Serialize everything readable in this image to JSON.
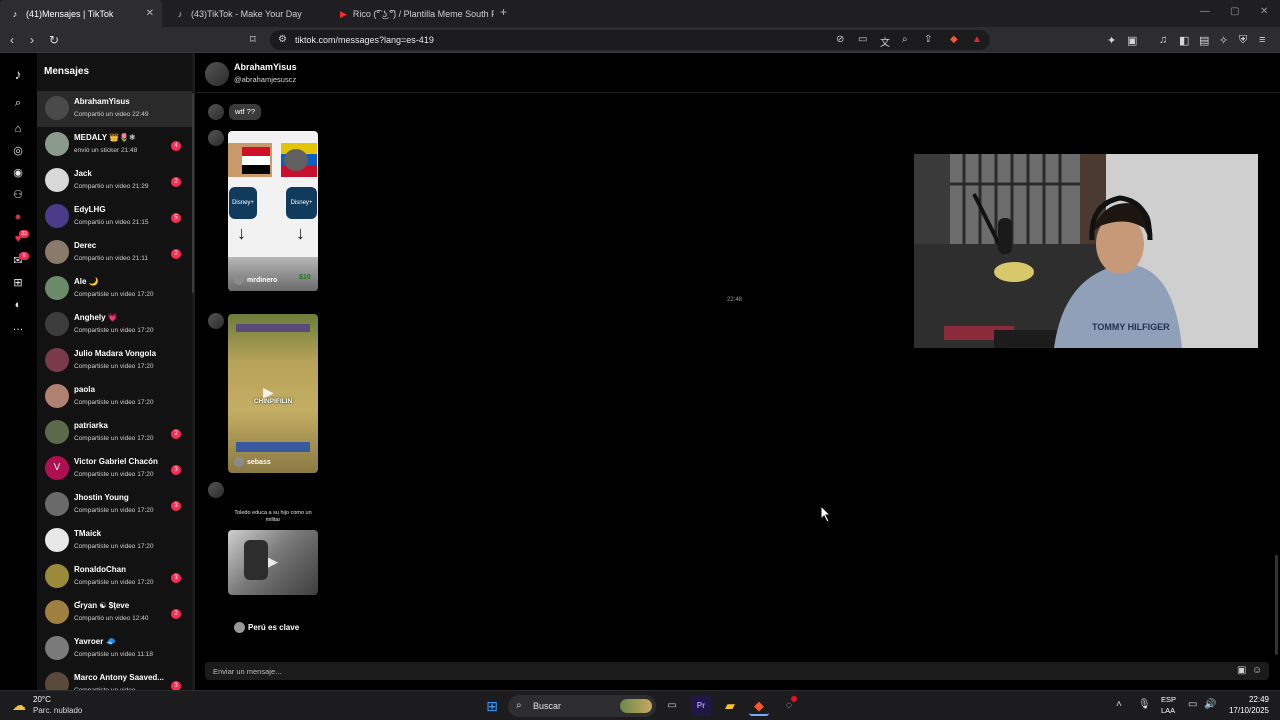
{
  "browser": {
    "tabs": [
      {
        "title": "(41)Mensajes | TikTok",
        "icon": "tiktok-icon",
        "active": true
      },
      {
        "title": "(43)TikTok - Make Your Day",
        "icon": "tiktok-icon",
        "active": false
      },
      {
        "title": "Rico (͡° ͜ʖ ͡°) / Plantilla Meme South P...",
        "icon": "youtube-icon",
        "active": false
      }
    ],
    "new_tab": "+",
    "url": "tiktok.com/messages?lang=es-419"
  },
  "sidebar": {
    "title": "Mensajes",
    "notification_badges": [
      "33",
      "8"
    ]
  },
  "conversations": [
    {
      "name": "AbrahamYisus",
      "preview": "Compartió un video 22:49",
      "badge": "",
      "selected": true,
      "color": "#4a4a4a",
      "initial": ""
    },
    {
      "name": "MEDALY 👑🌷❄",
      "preview": "envió un sticker 21:48",
      "badge": "4",
      "selected": false,
      "color": "#8a9a8a",
      "initial": ""
    },
    {
      "name": "Jack",
      "preview": "Compartió un video 21:29",
      "badge": "2",
      "selected": false,
      "color": "#d8d8d8",
      "initial": ""
    },
    {
      "name": "EdyLHG",
      "preview": "Compartió un video 21:15",
      "badge": "5",
      "selected": false,
      "color": "#4b3c8a",
      "initial": ""
    },
    {
      "name": "Derec",
      "preview": "Compartió un video 21:11",
      "badge": "2",
      "selected": false,
      "color": "#8a7a6a",
      "initial": ""
    },
    {
      "name": "Ale 🌙",
      "preview": "Compartiste un video 17:20",
      "badge": "",
      "selected": false,
      "color": "#6a8a6a",
      "initial": ""
    },
    {
      "name": "Anghely 💗",
      "preview": "Compartiste un video 17:20",
      "badge": "",
      "selected": false,
      "color": "#3c3c3c",
      "initial": ""
    },
    {
      "name": "Julio Madara Vongola",
      "preview": "Compartiste un video 17:20",
      "badge": "",
      "selected": false,
      "color": "#7a3a4a",
      "initial": ""
    },
    {
      "name": "paola",
      "preview": "Compartiste un video 17:20",
      "badge": "",
      "selected": false,
      "color": "#b08070",
      "initial": ""
    },
    {
      "name": "patriarka",
      "preview": "Compartiste un video 17:20",
      "badge": "2",
      "selected": false,
      "color": "#5a6a4a",
      "initial": ""
    },
    {
      "name": "Victor Gabriel Chacón",
      "preview": "Compartiste un video 17:20",
      "badge": "3",
      "selected": false,
      "color": "#b01050",
      "initial": "V"
    },
    {
      "name": "Jhostin Young",
      "preview": "Compartiste un video 17:20",
      "badge": "3",
      "selected": false,
      "color": "#6a6a6a",
      "initial": ""
    },
    {
      "name": "TMaick",
      "preview": "Compartiste un video 17:20",
      "badge": "",
      "selected": false,
      "color": "#e8e8e8",
      "initial": ""
    },
    {
      "name": "RonaldoChan",
      "preview": "Compartiste un video 17:20",
      "badge": "3",
      "selected": false,
      "color": "#9a8a3a",
      "initial": ""
    },
    {
      "name": "Ɠryan ☯ $ţeve",
      "preview": "Compartió un video 12:40",
      "badge": "2",
      "selected": false,
      "color": "#a08040",
      "initial": ""
    },
    {
      "name": "Yavroer 🧢",
      "preview": "Compartiste un video 11:18",
      "badge": "",
      "selected": false,
      "color": "#7a7a7a",
      "initial": ""
    },
    {
      "name": "Marco Antony Saaved...",
      "preview": "Compartiste un video",
      "badge": "3",
      "selected": false,
      "color": "#5a4a3a",
      "initial": ""
    }
  ],
  "chat": {
    "name": "AbrahamYisus",
    "handle": "@abrahamjesuscz",
    "messages": {
      "text": "wtf ??",
      "video1_user": "mrdinero",
      "video1_price": "$10",
      "video2_user": "sebass",
      "video2_label": "CHINPIFILIN",
      "timestamp": "22:48",
      "video3_caption": "Toledo educa a su hijo como un militar",
      "shared_name": "Perú es clave"
    },
    "input_placeholder": "Enviar un mensaje..."
  },
  "taskbar": {
    "temperature": "20°C",
    "weather": "Parc. nublado",
    "search": "Buscar",
    "lang_line1": "ESP",
    "lang_line2": "LAA",
    "time": "22:49",
    "date": "17/10/2025"
  },
  "colors": {
    "accent": "#fe2c55",
    "background": "#000000",
    "panel": "#121212"
  }
}
